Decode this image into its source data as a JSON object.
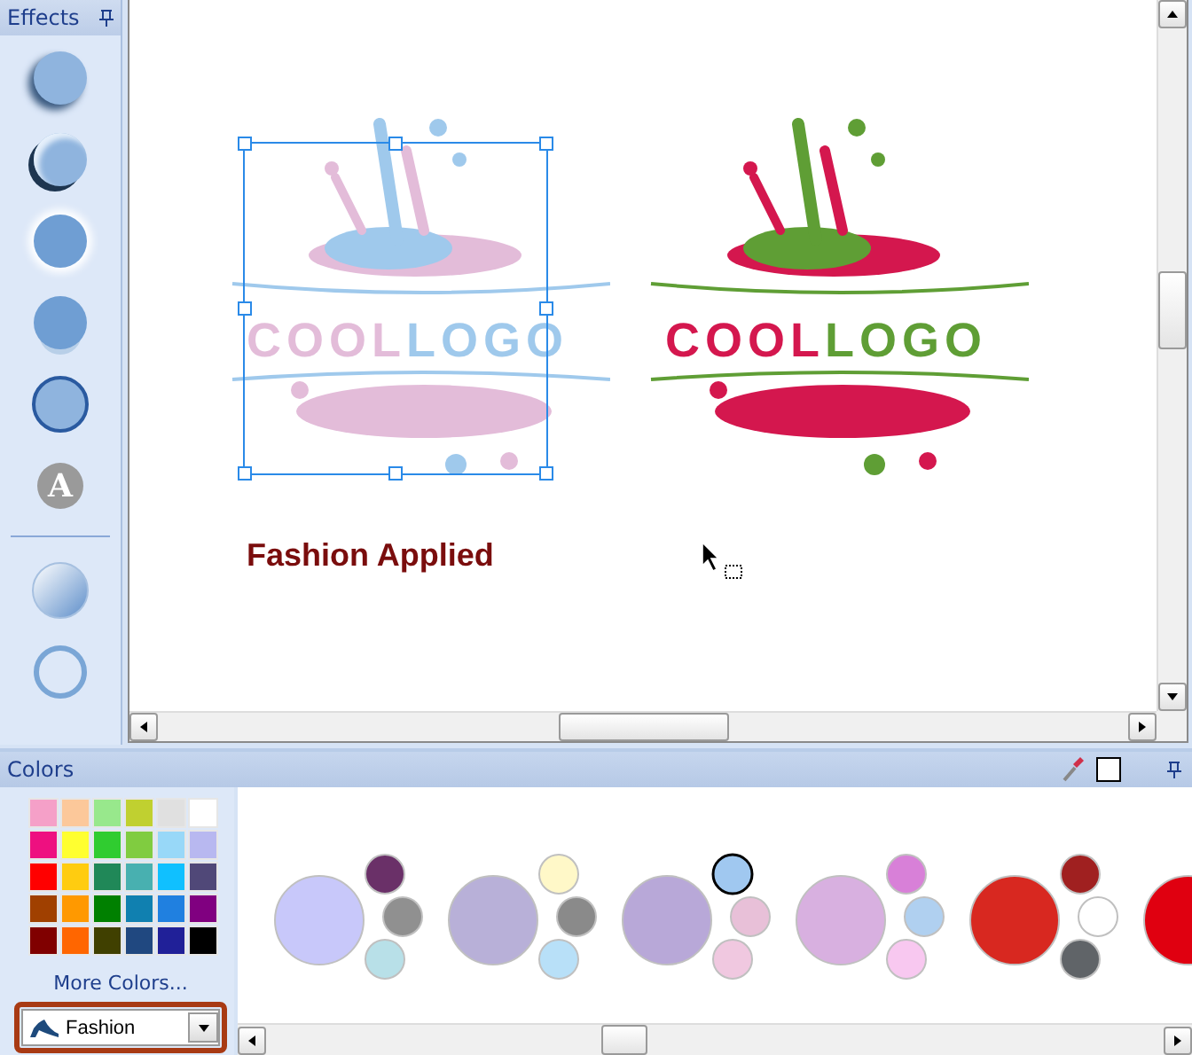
{
  "effects_panel": {
    "title": "Effects",
    "groups": [
      [
        {
          "kind": "shadow"
        },
        {
          "kind": "bevel"
        },
        {
          "kind": "glow"
        },
        {
          "kind": "reflection"
        },
        {
          "kind": "outline"
        },
        {
          "kind": "text",
          "label": "A"
        }
      ],
      [
        {
          "kind": "gradient"
        },
        {
          "kind": "ring"
        }
      ]
    ]
  },
  "canvas": {
    "logos": [
      {
        "words": [
          {
            "text": "COOL",
            "color": "#e3bcd9"
          },
          {
            "text": "LOGO",
            "color": "#9fc9ec"
          }
        ],
        "selected": true
      },
      {
        "words": [
          {
            "text": "COOL",
            "color": "#d4174e"
          },
          {
            "text": "LOGO",
            "color": "#5f9e35"
          }
        ],
        "selected": false
      }
    ],
    "annotation": "Fashion Applied"
  },
  "colors_panel": {
    "title": "Colors",
    "swatches": [
      [
        {
          "color": "#f5a0c8"
        },
        {
          "color": "#fcc89a"
        },
        {
          "color": "#98e88c"
        },
        {
          "color": "#c0d030"
        },
        {
          "color": "#e0e0e0"
        },
        {
          "color": "#ffffff"
        }
      ],
      [
        {
          "color": "#ee1080"
        },
        {
          "color": "#ffff30"
        },
        {
          "color": "#30cc30"
        },
        {
          "color": "#80cc40"
        },
        {
          "color": "#98d8f8"
        },
        {
          "color": "#b8b8f0"
        }
      ],
      [
        {
          "color": "#ff0000"
        },
        {
          "color": "#ffcc10"
        },
        {
          "color": "#208858"
        },
        {
          "color": "#48b0b0"
        },
        {
          "color": "#10c0ff"
        },
        {
          "color": "#504878"
        }
      ],
      [
        {
          "color": "#a04000"
        },
        {
          "color": "#ff9900"
        },
        {
          "color": "#008000"
        },
        {
          "color": "#1080b0"
        },
        {
          "color": "#2080e0"
        },
        {
          "color": "#800080"
        }
      ],
      [
        {
          "color": "#800000"
        },
        {
          "color": "#ff6600"
        },
        {
          "color": "#404000"
        },
        {
          "color": "#204880"
        },
        {
          "color": "#202098"
        },
        {
          "color": "#000000"
        }
      ]
    ],
    "more_colors": "More Colors...",
    "scheme_dropdown": {
      "value": "Fashion"
    },
    "schemes": [
      {
        "color": "#c8c8fa",
        "accents": [
          {
            "color": "#6a3068",
            "selected": false
          },
          {
            "color": "#909090",
            "selected": false
          },
          {
            "color": "#b8e0e8",
            "selected": false
          }
        ]
      },
      {
        "color": "#b8b0d8",
        "accents": [
          {
            "color": "#fff8c8",
            "selected": false
          },
          {
            "color": "#8a8a8a",
            "selected": false
          },
          {
            "color": "#b8e0f8",
            "selected": false
          }
        ]
      },
      {
        "color": "#b8a8d8",
        "accents": [
          {
            "color": "#a0c8f0",
            "selected": true
          },
          {
            "color": "#e8c0d8",
            "selected": false
          },
          {
            "color": "#f0c8e0",
            "selected": false
          }
        ]
      },
      {
        "color": "#d8b0e0",
        "accents": [
          {
            "color": "#d880d8",
            "selected": false
          },
          {
            "color": "#b0d0f0",
            "selected": false
          },
          {
            "color": "#f8c8f0",
            "selected": false
          }
        ]
      },
      {
        "color": "#d82820",
        "accents": [
          {
            "color": "#a02020",
            "selected": false
          },
          {
            "color": "#ffffff",
            "selected": false
          },
          {
            "color": "#606468",
            "selected": false
          }
        ]
      },
      {
        "color": "#e00010"
      }
    ]
  }
}
